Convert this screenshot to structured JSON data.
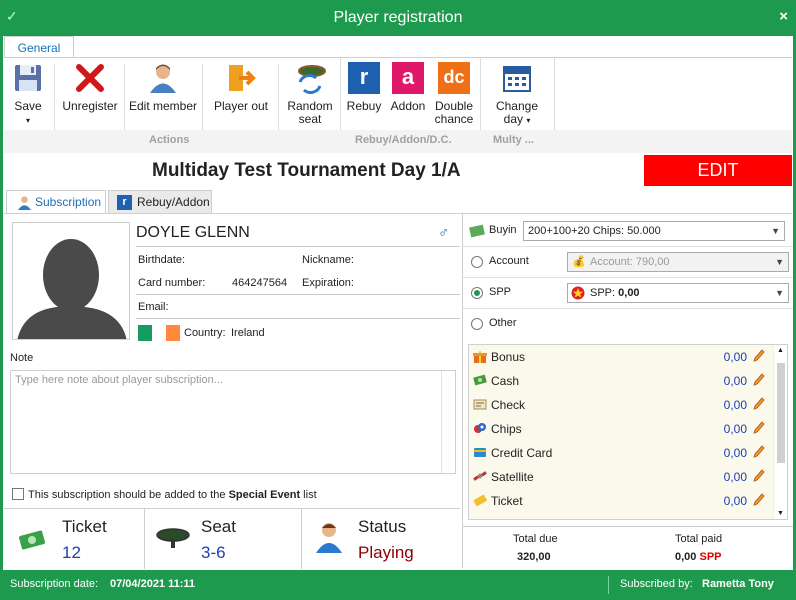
{
  "window": {
    "title": "Player registration",
    "close": "×"
  },
  "ribbon": {
    "tab": "General",
    "buttons": {
      "save": "Save",
      "unregister": "Unregister",
      "edit_member": "Edit member",
      "player_out": "Player out",
      "random_seat_1": "Random",
      "random_seat_2": "seat",
      "rebuy": "Rebuy",
      "addon": "Addon",
      "double_chance_1": "Double",
      "double_chance_2": "chance",
      "change_day_1": "Change",
      "change_day_2": "day"
    },
    "icons": {
      "rebuy": "r",
      "addon": "a",
      "double": "dc"
    },
    "groups": {
      "actions": "Actions",
      "rebuy": "Rebuy/Addon/D.C.",
      "multy": "Multy ..."
    }
  },
  "header": {
    "title": "Multiday Test Tournament  Day 1/A",
    "edit": "EDIT"
  },
  "tabs": {
    "subscription": "Subscription",
    "rebuy": "Rebuy/Addon"
  },
  "player": {
    "name": "DOYLE GLENN",
    "birthdate_label": "Birthdate:",
    "nickname_label": "Nickname:",
    "card_label": "Card number:",
    "card_value": "464247564",
    "expiration_label": "Expiration:",
    "email_label": "Email:",
    "country_label": "Country:",
    "country_value": "Ireland"
  },
  "note": {
    "label": "Note",
    "placeholder": "Type here note about player subscription..."
  },
  "special_event": {
    "text": "This subscription should be added to the ",
    "bold": "Special Event",
    "tail": " list"
  },
  "bottom": {
    "ticket_label": "Ticket",
    "ticket_value": "12",
    "seat_label": "Seat",
    "seat_value": "3-6",
    "status_label": "Status",
    "status_value": "Playing"
  },
  "payment": {
    "buyin_label": "Buyin",
    "buyin_value": "200+100+20 Chips: 50.000",
    "account_label": "Account",
    "account_value": "Account: 790,00",
    "spp_label": "SPP",
    "spp_value_label": "SPP:",
    "spp_value": "0,00",
    "other_label": "Other",
    "methods": [
      {
        "name": "Bonus",
        "value": "0,00"
      },
      {
        "name": "Cash",
        "value": "0,00"
      },
      {
        "name": "Check",
        "value": "0,00"
      },
      {
        "name": "Chips",
        "value": "0,00"
      },
      {
        "name": "Credit Card",
        "value": "0,00"
      },
      {
        "name": "Satellite",
        "value": "0,00"
      },
      {
        "name": "Ticket",
        "value": "0,00"
      }
    ]
  },
  "totals": {
    "due_label": "Total due",
    "due_value": "320,00",
    "paid_label": "Total paid",
    "paid_value": "0,00",
    "paid_currency": "SPP"
  },
  "statusbar": {
    "date_label": "Subscription date:",
    "date_value": "07/04/2021 11:11",
    "by_label": "Subscribed by:",
    "by_value": "Rametta Tony"
  },
  "colors": {
    "accent": "#1e9a4e",
    "edit": "#ff0000",
    "blue": "#1b6fb5",
    "status": "#8b0000"
  }
}
